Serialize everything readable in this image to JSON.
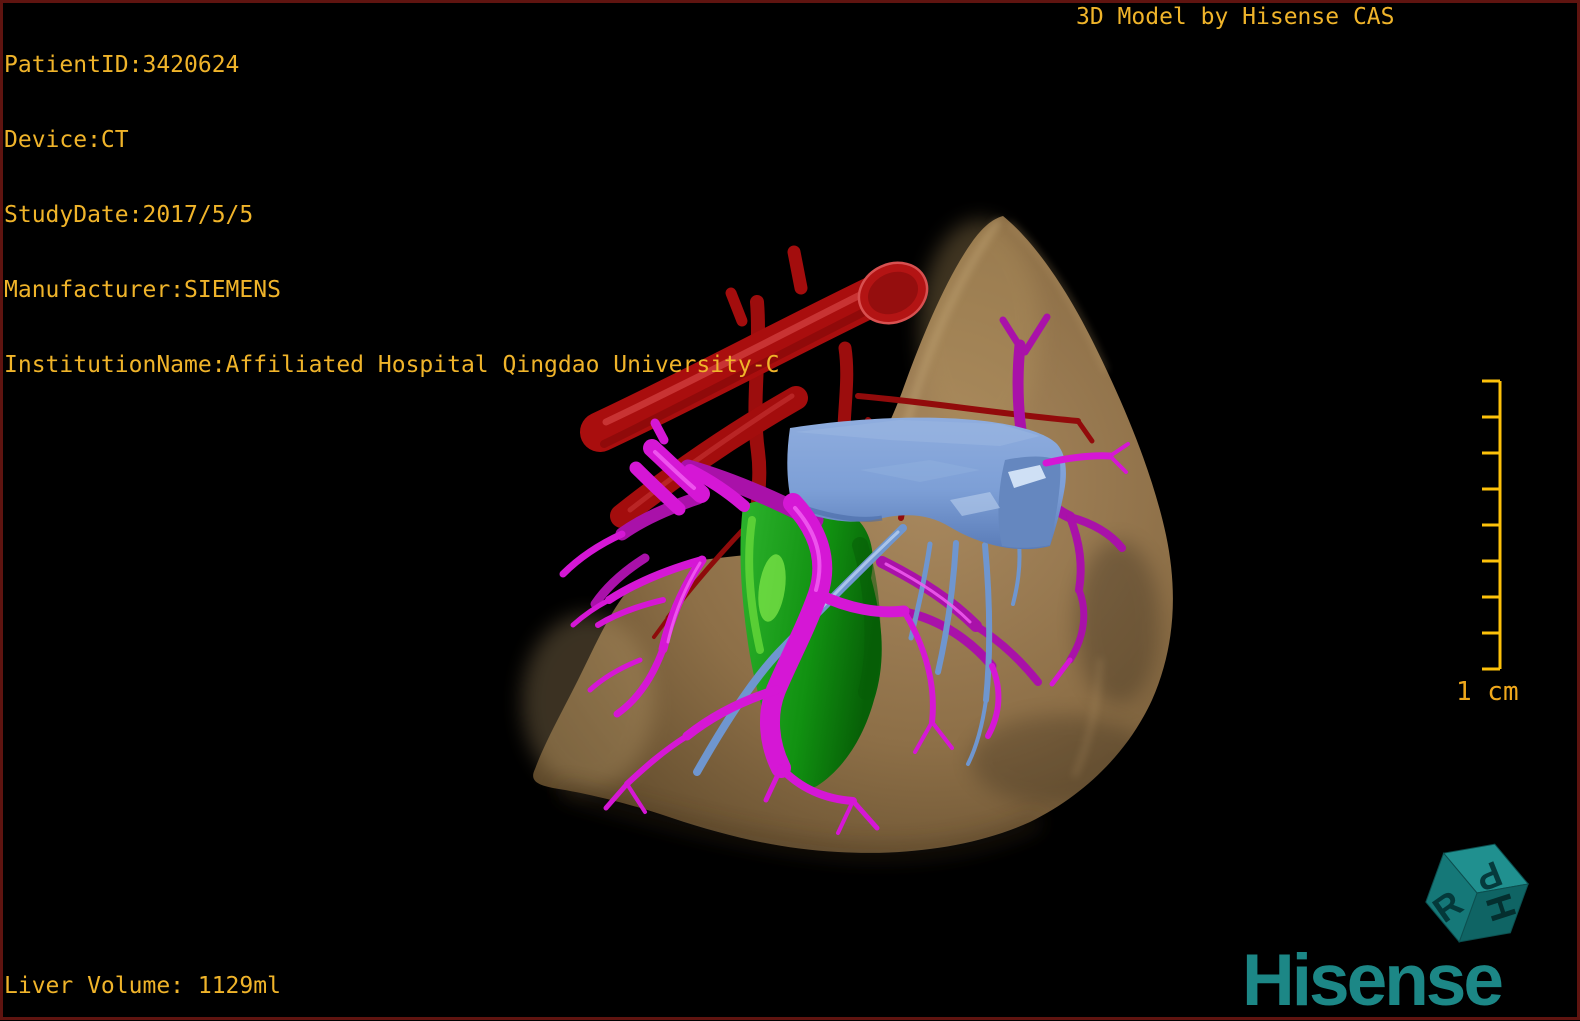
{
  "patient_info": {
    "lines": [
      "PatientID:3420624",
      "Device:CT",
      "StudyDate:2017/5/5",
      "Manufacturer:SIEMENS",
      "InstitutionName:Affiliated Hospital Qingdao University-C"
    ]
  },
  "watermark": {
    "title": "3D Model by Hisense CAS"
  },
  "measurements": {
    "liver_volume": "Liver Volume: 1129ml"
  },
  "scale_bar": {
    "label": "1 cm",
    "tick_count": 9,
    "tick_spacing_cm": 1
  },
  "branding": {
    "wordmark": "Hisense",
    "cube_letters": {
      "top": "P",
      "right": "H",
      "front": "R"
    }
  },
  "colors": {
    "overlay_text": "#f0b42a",
    "scale_bar": "#fdc10a",
    "brand_teal": "#1c8786",
    "frame_border": "#5f1410",
    "liver_parenchyma": "#94764e",
    "hepatic_artery_red": "#a90e0e",
    "portal_vein_magenta": "#d517d5",
    "hepatic_vein_blue": "#7d9fd6",
    "gallbladder_green": "#18a018",
    "background": "#000000"
  }
}
